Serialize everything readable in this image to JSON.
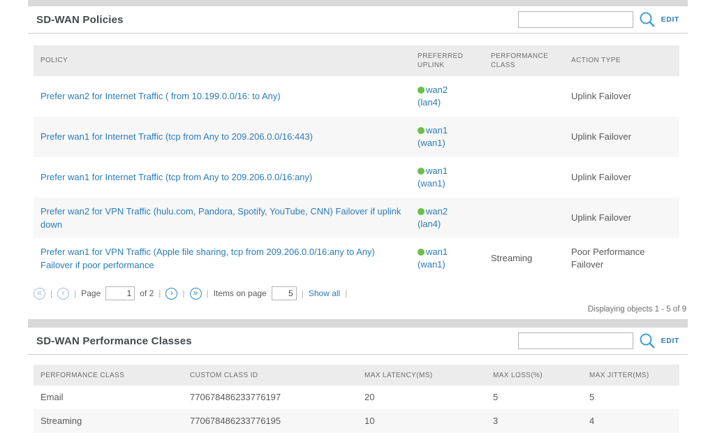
{
  "colors": {
    "link_blue": "#2b7bb9",
    "icon_blue": "#3f9fd0",
    "dot_green": "#6bbf47",
    "bar_gray": "#d9d9d9",
    "header_gray": "#ececec",
    "row_alt_gray": "#f7f7f7"
  },
  "policies_section": {
    "title": "SD-WAN Policies",
    "search_value": "",
    "edit_label": "EDIT",
    "table": {
      "columns": [
        "POLICY",
        "PREFERRED UPLINK",
        "PERFORMANCE CLASS",
        "ACTION TYPE"
      ],
      "rows": [
        {
          "policy": "Prefer wan2 for Internet Traffic ( from 10.199.0.0/16: to Any)",
          "uplink_name": "wan2",
          "uplink_port": "(lan4)",
          "performance_class": "",
          "action_type": "Uplink Failover"
        },
        {
          "policy": "Prefer wan1 for Internet Traffic (tcp from Any to 209.206.0.0/16:443)",
          "uplink_name": "wan1",
          "uplink_port": "(wan1)",
          "performance_class": "",
          "action_type": "Uplink Failover"
        },
        {
          "policy": "Prefer wan1 for Internet Traffic (tcp from Any to 209.206.0.0/16:any)",
          "uplink_name": "wan1",
          "uplink_port": "(wan1)",
          "performance_class": "",
          "action_type": "Uplink Failover"
        },
        {
          "policy": "Prefer wan2 for VPN Traffic (hulu.com, Pandora, Spotify, YouTube, CNN) Failover if uplink down",
          "uplink_name": "wan2",
          "uplink_port": "(lan4)",
          "performance_class": "",
          "action_type": "Uplink Failover"
        },
        {
          "policy": "Prefer wan1 for VPN Traffic (Apple file sharing, tcp from 209.206.0.0/16:any to Any) Failover if poor performance",
          "uplink_name": "wan1",
          "uplink_port": "(wan1)",
          "performance_class": "Streaming",
          "action_type": "Poor Performance Failover"
        }
      ]
    },
    "pagination": {
      "first_icon": "«",
      "prev_icon": "‹",
      "next_icon": "›",
      "last_icon": "»",
      "separator": "|",
      "page_label": "Page",
      "page_value": "1",
      "of_label": "of 2",
      "items_label": "Items on page",
      "items_value": "5",
      "show_all_label": "Show all"
    },
    "summary": "Displaying objects 1 - 5 of 9"
  },
  "classes_section": {
    "title": "SD-WAN Performance Classes",
    "search_value": "",
    "edit_label": "EDIT",
    "table": {
      "columns": [
        "PERFORMANCE CLASS",
        "CUSTOM CLASS ID",
        "MAX LATENCY(MS)",
        "MAX LOSS(%)",
        "MAX JITTER(MS)"
      ],
      "rows": [
        {
          "name": "Email",
          "custom_id": "770678486233776197",
          "max_latency": "20",
          "max_loss": "5",
          "max_jitter": "5"
        },
        {
          "name": "Streaming",
          "custom_id": "770678486233776195",
          "max_latency": "10",
          "max_loss": "3",
          "max_jitter": "4"
        }
      ]
    }
  }
}
